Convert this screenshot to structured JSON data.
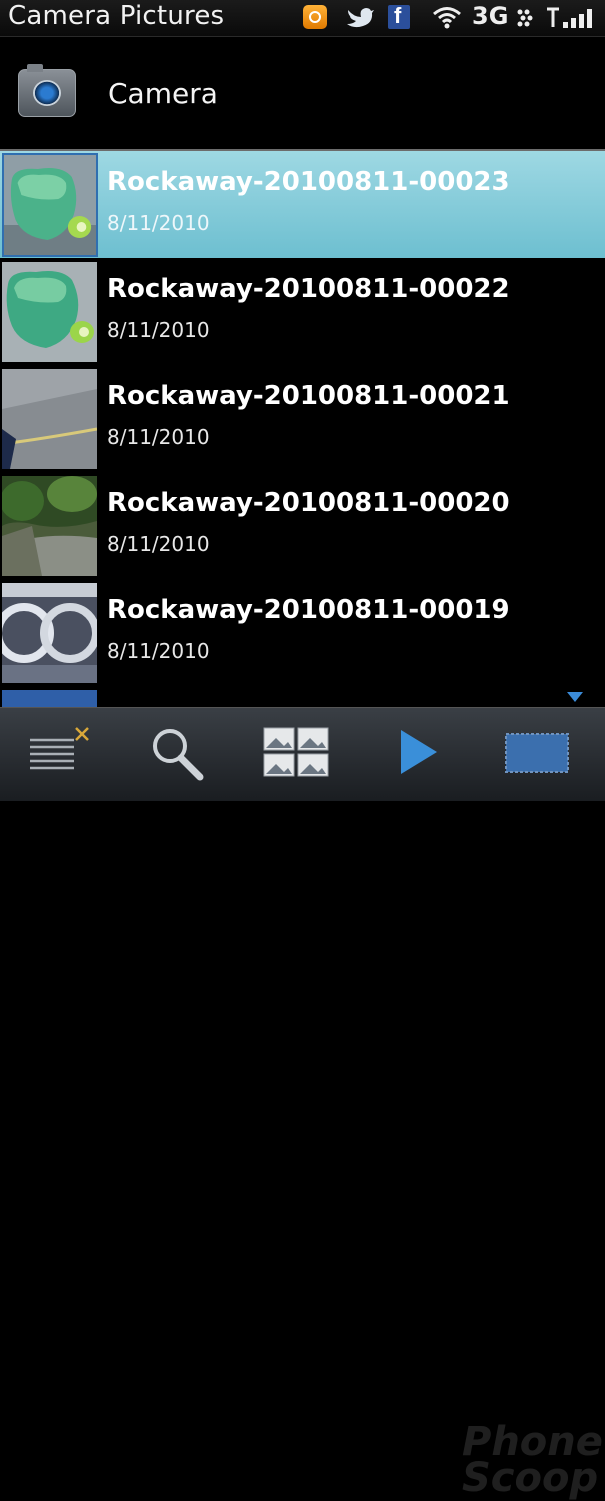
{
  "status_bar": {
    "title": "Camera Pictures",
    "network": "3G",
    "icons": [
      "bbm-icon",
      "twitter-icon",
      "facebook-icon",
      "wifi-icon",
      "blackberry-icon",
      "signal-icon"
    ]
  },
  "folder": {
    "icon": "camera-icon",
    "label": "Camera"
  },
  "pictures": [
    {
      "name": "Rockaway-20100811-00023",
      "date": "8/11/2010",
      "selected": true
    },
    {
      "name": "Rockaway-20100811-00022",
      "date": "8/11/2010",
      "selected": false
    },
    {
      "name": "Rockaway-20100811-00021",
      "date": "8/11/2010",
      "selected": false
    },
    {
      "name": "Rockaway-20100811-00020",
      "date": "8/11/2010",
      "selected": false
    },
    {
      "name": "Rockaway-20100811-00019",
      "date": "8/11/2010",
      "selected": false
    }
  ],
  "toolbar": {
    "buttons": [
      "menu-icon",
      "search-icon",
      "grid-view-icon",
      "play-icon",
      "slideshow-icon"
    ]
  },
  "colors": {
    "selection": "#8fd0dc",
    "accent": "#3b8bd8"
  },
  "watermark": "Phone Scoop"
}
